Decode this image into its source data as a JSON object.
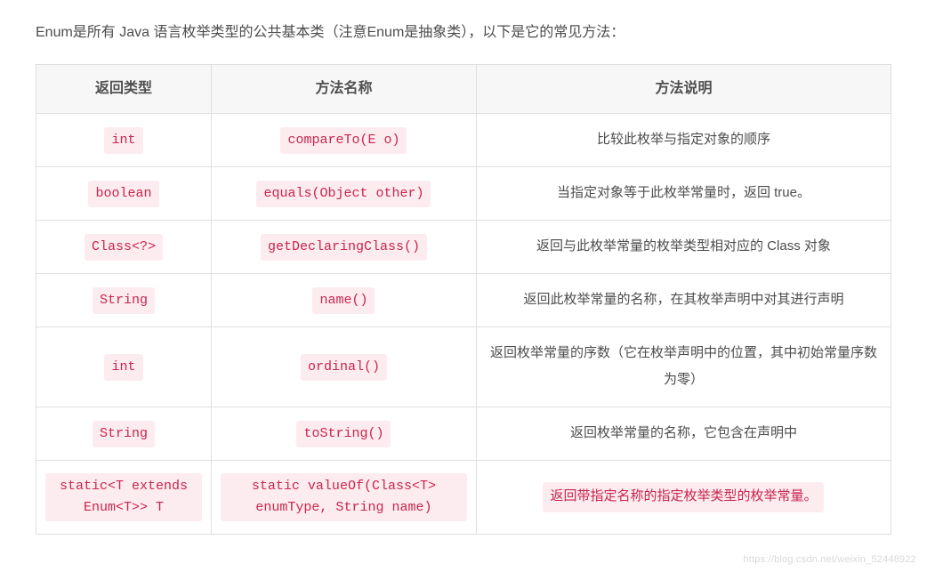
{
  "intro": "Enum是所有 Java 语言枚举类型的公共基本类（注意Enum是抽象类），以下是它的常见方法：",
  "headers": {
    "col1": "返回类型",
    "col2": "方法名称",
    "col3": "方法说明"
  },
  "rows": [
    {
      "return_type": "int",
      "method": "compareTo(E o)",
      "desc": "比较此枚举与指定对象的顺序",
      "desc_highlighted": false
    },
    {
      "return_type": "boolean",
      "method": "equals(Object other)",
      "desc": "当指定对象等于此枚举常量时，返回 true。",
      "desc_highlighted": false
    },
    {
      "return_type": "Class<?>",
      "method": "getDeclaringClass()",
      "desc": "返回与此枚举常量的枚举类型相对应的 Class 对象",
      "desc_highlighted": false
    },
    {
      "return_type": "String",
      "method": "name()",
      "desc": "返回此枚举常量的名称，在其枚举声明中对其进行声明",
      "desc_highlighted": false
    },
    {
      "return_type": "int",
      "method": "ordinal()",
      "desc": "返回枚举常量的序数（它在枚举声明中的位置，其中初始常量序数为零）",
      "desc_highlighted": false
    },
    {
      "return_type": "String",
      "method": "toString()",
      "desc": "返回枚举常量的名称，它包含在声明中",
      "desc_highlighted": false
    },
    {
      "return_type": "static<T extends Enum<T>> T",
      "method": "static valueOf(Class<T> enumType, String name)",
      "desc": "返回带指定名称的指定枚举类型的枚举常量。",
      "desc_highlighted": true
    }
  ],
  "watermark": "https://blog.csdn.net/weixin_52448922"
}
